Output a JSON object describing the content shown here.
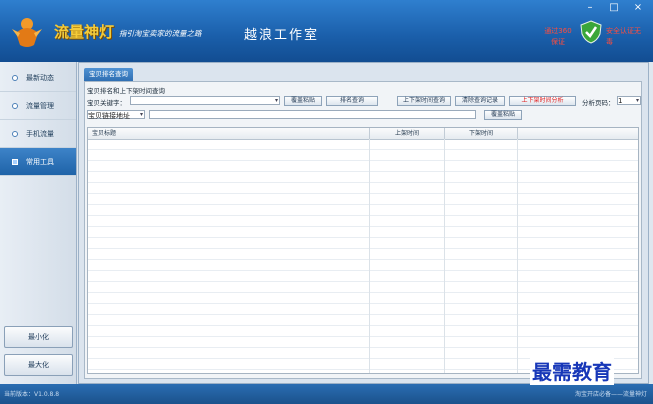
{
  "window_controls": [
    "–",
    "□",
    "×"
  ],
  "header": {
    "app_title": "流量神灯",
    "slogan": "指引淘宝卖家的流量之路",
    "studio": "越浪工作室",
    "badge_left": "通过360保证",
    "badge_right": "安全认证无毒",
    "colors": {
      "bg": "#1a5ea9",
      "title": "#f4cb39",
      "badge": "#ff4d3d"
    }
  },
  "sidebar": {
    "items": [
      {
        "label": "最新动态",
        "active": false
      },
      {
        "label": "流量管理",
        "active": false
      },
      {
        "label": "手机流量",
        "active": false
      },
      {
        "label": "常用工具",
        "active": true
      }
    ],
    "minimize_label": "最小化",
    "maximize_label": "最大化"
  },
  "main": {
    "tab": "宝贝排名查询",
    "section_title": "宝贝排名和上下架时间查询",
    "keyword_label": "宝贝关键字：",
    "keyword_value": "",
    "paste_btn": "覆盖粘贴",
    "rank_query_btn": "排名查询",
    "shelf_time_query_btn": "上下架时间查询",
    "clear_history_btn": "清除查询记录",
    "shelf_time_analysis_btn": "上下架时间分析",
    "page_label": "分析页码：",
    "page_value": "1",
    "link_select": "宝贝链接地址",
    "link_value": "",
    "paste_btn_2": "覆盖粘贴",
    "table": {
      "columns": [
        "宝贝标题",
        "上架时间",
        "下架时间",
        ""
      ],
      "rows": []
    }
  },
  "status": {
    "version": "当前版本：V1.0.8.8",
    "right": "淘宝开店必备——流量神灯"
  },
  "watermark": "最需教育"
}
